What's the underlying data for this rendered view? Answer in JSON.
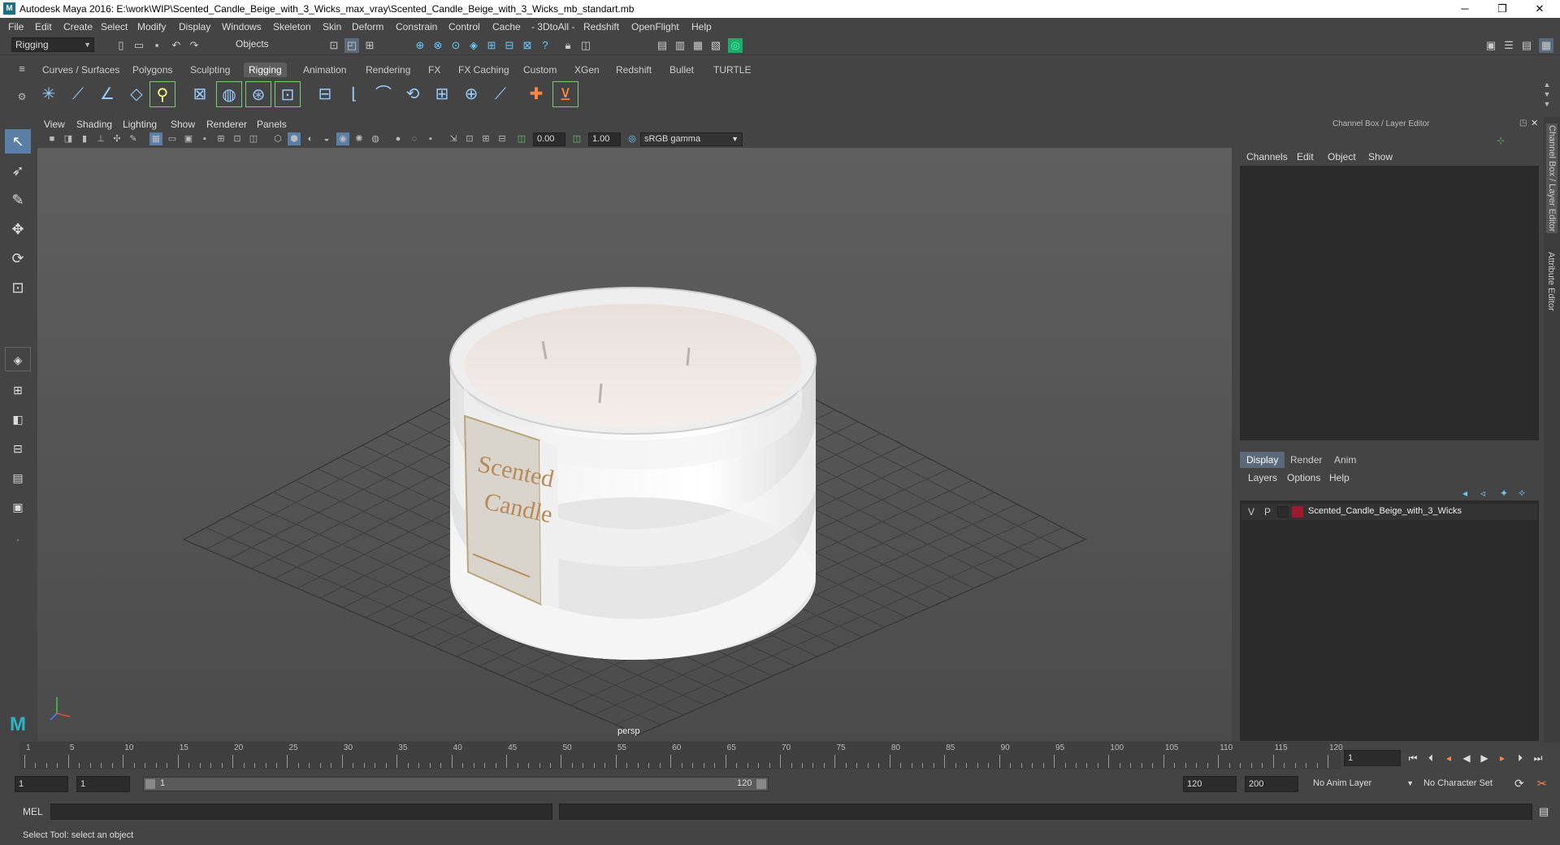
{
  "window": {
    "title": "Autodesk Maya 2016: E:\\work\\WIP\\Scented_Candle_Beige_with_3_Wicks_max_vray\\Scented_Candle_Beige_with_3_Wicks_mb_standart.mb",
    "minimize": "─",
    "restore": "❐",
    "close": "✕"
  },
  "menu": [
    "File",
    "Edit",
    "Create",
    "Select",
    "Modify",
    "Display",
    "Windows",
    "Skeleton",
    "Skin",
    "Deform",
    "Constrain",
    "Control",
    "Cache",
    "- 3DtoAll -",
    "Redshift",
    "OpenFlight",
    "Help"
  ],
  "status": {
    "menu_set": "Rigging",
    "selection_mode": "Objects"
  },
  "shelf_tabs": [
    "Curves / Surfaces",
    "Polygons",
    "Sculpting",
    "Rigging",
    "Animation",
    "Rendering",
    "FX",
    "FX Caching",
    "Custom",
    "XGen",
    "Redshift",
    "Bullet",
    "TURTLE"
  ],
  "active_shelf_tab": "Rigging",
  "viewport": {
    "menus": [
      "View",
      "Shading",
      "Lighting",
      "Show",
      "Renderer",
      "Panels"
    ],
    "exposure": "0.00",
    "gamma": "1.00",
    "color_space": "sRGB gamma",
    "camera_label": "persp",
    "label_text_1": "Scented",
    "label_text_2": "Candle"
  },
  "channel_box": {
    "title": "Channel Box / Layer Editor",
    "menus": [
      "Channels",
      "Edit",
      "Object",
      "Show"
    ]
  },
  "layer_editor": {
    "tabs": [
      "Display",
      "Render",
      "Anim"
    ],
    "active_tab": "Display",
    "menus": [
      "Layers",
      "Options",
      "Help"
    ],
    "layers": [
      {
        "v": "V",
        "p": "P",
        "name": "Scented_Candle_Beige_with_3_Wicks",
        "color": "#9b1a2e"
      }
    ]
  },
  "side_tabs": {
    "channel": "Channel Box / Layer Editor",
    "attribute": "Attribute Editor"
  },
  "timeline": {
    "ticks": [
      "1",
      "5",
      "10",
      "15",
      "20",
      "25",
      "30",
      "35",
      "40",
      "45",
      "50",
      "55",
      "60",
      "65",
      "70",
      "75",
      "80",
      "85",
      "90",
      "95",
      "100",
      "105",
      "110",
      "115",
      "120"
    ],
    "current_frame": "1"
  },
  "range": {
    "start": "1",
    "playback_start": "1",
    "slider_start": "1",
    "slider_end": "120",
    "playback_end": "120",
    "end": "200",
    "anim_layer": "No Anim Layer",
    "character_set": "No Character Set"
  },
  "command": {
    "label": "MEL"
  },
  "help_line": "Select Tool: select an object",
  "colors": {
    "ui_bg": "#444444",
    "field_bg": "#2b2b2b",
    "active_tab": "#5d5d5d",
    "accent": "#5a6a7a"
  }
}
